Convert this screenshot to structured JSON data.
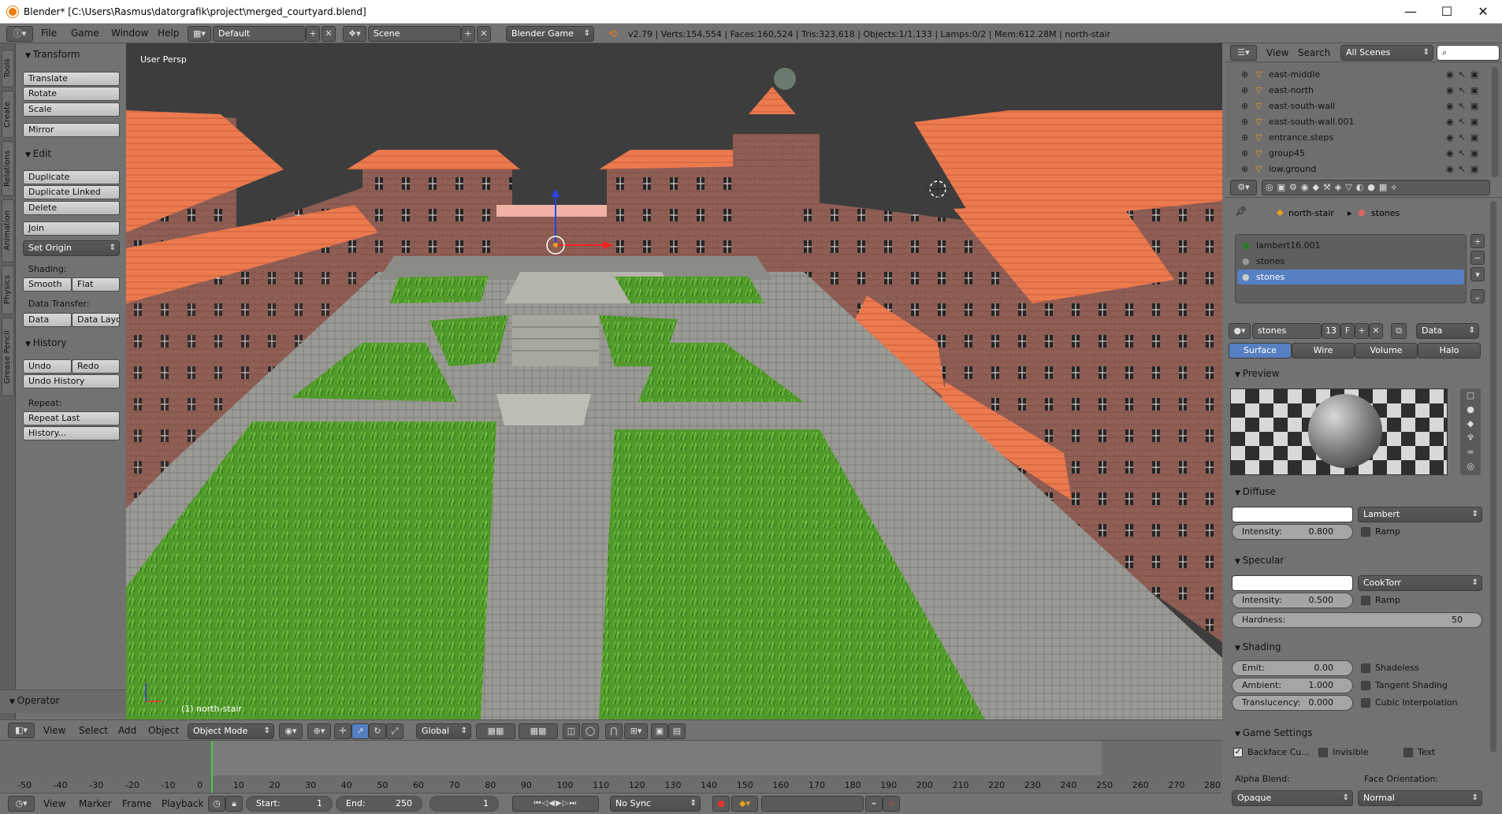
{
  "window": {
    "title": "Blender* [C:\\Users\\Rasmus\\datorgrafik\\project\\merged_courtyard.blend]",
    "controls": [
      "—",
      "☐",
      "✕"
    ]
  },
  "infobar": {
    "menus": [
      "File",
      "Game",
      "Window",
      "Help"
    ],
    "layout": "Default",
    "scene": "Scene",
    "engine": "Blender Game",
    "stats": "v2.79 | Verts:154,554 | Faces:160,524 | Tris:323,618 | Objects:1/1,133 | Lamps:0/2 | Mem:612.28M | north-stair"
  },
  "shelf": {
    "tabs": [
      "Tools",
      "Create",
      "Relations",
      "Animation",
      "Physics",
      "Grease Pencil"
    ],
    "transform": {
      "title": "Transform",
      "buttons": [
        "Translate",
        "Rotate",
        "Scale",
        "Mirror"
      ]
    },
    "edit": {
      "title": "Edit",
      "buttons": [
        "Duplicate",
        "Duplicate Linked",
        "Delete",
        "Join"
      ],
      "set_origin": "Set Origin",
      "shading_label": "Shading:",
      "smooth": "Smooth",
      "flat": "Flat",
      "data_transfer_label": "Data Transfer:",
      "data": "Data",
      "data_layout": "Data Layo"
    },
    "history": {
      "title": "History",
      "undo": "Undo",
      "redo": "Redo",
      "undo_history": "Undo History",
      "repeat_label": "Repeat:",
      "repeat_last": "Repeat Last",
      "history": "History..."
    },
    "operator": "Operator"
  },
  "viewport": {
    "label": "User Persp",
    "object_label": "(1) north-stair"
  },
  "view_header": {
    "menus": [
      "View",
      "Select",
      "Add",
      "Object"
    ],
    "mode": "Object Mode",
    "orientation": "Global"
  },
  "outliner": {
    "menus": [
      "View",
      "Search"
    ],
    "display": "All Scenes",
    "rows": [
      "east-middle",
      "east-north",
      "east-south-wall",
      "east-south-wall.001",
      "entrance.steps",
      "group45",
      "low.ground"
    ]
  },
  "props": {
    "breadcrumb_object": "north-stair",
    "breadcrumb_material": "stones",
    "slots": [
      "lambert16.001",
      "stones",
      "stones"
    ],
    "material_name": "stones",
    "users": "13",
    "fake": "F",
    "link": "Data",
    "tabs": [
      "Surface",
      "Wire",
      "Volume",
      "Halo"
    ],
    "preview_title": "Preview",
    "diffuse": {
      "title": "Diffuse",
      "shader": "Lambert",
      "intensity_label": "Intensity:",
      "intensity": "0.800",
      "ramp": "Ramp"
    },
    "specular": {
      "title": "Specular",
      "shader": "CookTorr",
      "intensity_label": "Intensity:",
      "intensity": "0.500",
      "ramp": "Ramp",
      "hardness_label": "Hardness:",
      "hardness": "50"
    },
    "shading": {
      "title": "Shading",
      "emit_label": "Emit:",
      "emit": "0.00",
      "ambient_label": "Ambient:",
      "ambient": "1.000",
      "translucency_label": "Translucency:",
      "translucency": "0.000",
      "shadeless": "Shadeless",
      "tangent": "Tangent Shading",
      "cubic": "Cubic Interpolation"
    },
    "game": {
      "title": "Game Settings",
      "backface": "Backface Cu...",
      "invisible": "Invisible",
      "text": "Text",
      "alpha_label": "Alpha Blend:",
      "alpha": "Opaque",
      "face_label": "Face Orientation:",
      "face": "Normal"
    }
  },
  "timeline": {
    "ticks": [
      "-50",
      "-40",
      "-30",
      "-20",
      "-10",
      "0",
      "10",
      "20",
      "30",
      "40",
      "50",
      "60",
      "70",
      "80",
      "90",
      "100",
      "110",
      "120",
      "130",
      "140",
      "150",
      "160",
      "170",
      "180",
      "190",
      "200",
      "210",
      "220",
      "230",
      "240",
      "250",
      "260",
      "270",
      "280"
    ]
  },
  "footer": {
    "menus": [
      "View",
      "Marker",
      "Frame",
      "Playback"
    ],
    "start_label": "Start:",
    "start": "1",
    "end_label": "End:",
    "end": "250",
    "current": "1",
    "sync": "No Sync"
  },
  "colors": {
    "selected": "#5680c2",
    "roof": "#e8744a",
    "grass": "#4f9a2a",
    "brick": "#8a5b52"
  }
}
